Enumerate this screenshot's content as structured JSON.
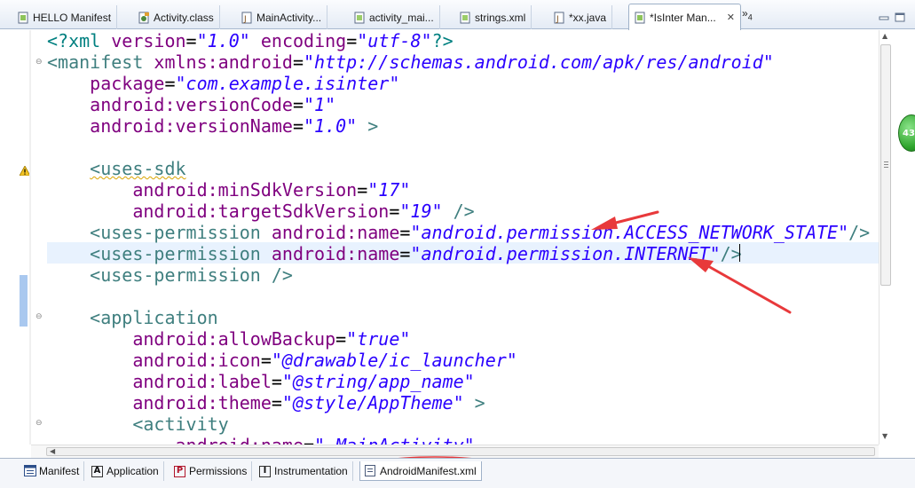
{
  "editor_tabs": [
    {
      "label": "HELLO Manifest",
      "icon": "android-manifest-icon"
    },
    {
      "label": "Activity.class",
      "icon": "class-file-icon"
    },
    {
      "label": "MainActivity...",
      "icon": "java-file-icon"
    },
    {
      "label": "activity_mai...",
      "icon": "xml-file-icon"
    },
    {
      "label": "strings.xml",
      "icon": "xml-file-icon"
    },
    {
      "label": "*xx.java",
      "icon": "java-file-icon"
    },
    {
      "label": "*IsInter Man...",
      "icon": "android-manifest-icon",
      "active": true
    }
  ],
  "tab_overflow": {
    "symbol": "»",
    "count": "4"
  },
  "code_lines": [
    [
      {
        "t": "<?xml ",
        "c": "punct"
      },
      {
        "t": "version",
        "c": "attr"
      },
      {
        "t": "=",
        "c": "plain"
      },
      {
        "t": "\"1.0\"",
        "c": "val"
      },
      {
        "t": " ",
        "c": "plain"
      },
      {
        "t": "encoding",
        "c": "attr"
      },
      {
        "t": "=",
        "c": "plain"
      },
      {
        "t": "\"utf-8\"",
        "c": "val"
      },
      {
        "t": "?>",
        "c": "punct"
      }
    ],
    [
      {
        "t": "<manifest ",
        "c": "tag"
      },
      {
        "t": "xmlns:android",
        "c": "attr"
      },
      {
        "t": "=",
        "c": "plain"
      },
      {
        "t": "\"http://schemas.android.com/apk/res/android\"",
        "c": "val"
      }
    ],
    [
      {
        "t": "    ",
        "c": "plain"
      },
      {
        "t": "package",
        "c": "attr"
      },
      {
        "t": "=",
        "c": "plain"
      },
      {
        "t": "\"com.example.isinter\"",
        "c": "val"
      }
    ],
    [
      {
        "t": "    ",
        "c": "plain"
      },
      {
        "t": "android:versionCode",
        "c": "attr"
      },
      {
        "t": "=",
        "c": "plain"
      },
      {
        "t": "\"1\"",
        "c": "val"
      }
    ],
    [
      {
        "t": "    ",
        "c": "plain"
      },
      {
        "t": "android:versionName",
        "c": "attr"
      },
      {
        "t": "=",
        "c": "plain"
      },
      {
        "t": "\"1.0\"",
        "c": "val"
      },
      {
        "t": " >",
        "c": "tag"
      }
    ],
    [],
    [
      {
        "t": "    ",
        "c": "plain"
      },
      {
        "t": "<uses-sdk",
        "c": "tag",
        "warn": true
      }
    ],
    [
      {
        "t": "        ",
        "c": "plain"
      },
      {
        "t": "android:minSdkVersion",
        "c": "attr"
      },
      {
        "t": "=",
        "c": "plain"
      },
      {
        "t": "\"17\"",
        "c": "val"
      }
    ],
    [
      {
        "t": "        ",
        "c": "plain"
      },
      {
        "t": "android:targetSdkVersion",
        "c": "attr"
      },
      {
        "t": "=",
        "c": "plain"
      },
      {
        "t": "\"19\"",
        "c": "val"
      },
      {
        "t": " />",
        "c": "tag"
      }
    ],
    [
      {
        "t": "    ",
        "c": "plain"
      },
      {
        "t": "<uses-permission ",
        "c": "tag"
      },
      {
        "t": "android:name",
        "c": "attr"
      },
      {
        "t": "=",
        "c": "plain"
      },
      {
        "t": "\"android.permission.ACCESS_NETWORK_STATE\"",
        "c": "val"
      },
      {
        "t": "/>",
        "c": "tag"
      }
    ],
    [
      {
        "t": "    ",
        "c": "plain"
      },
      {
        "t": "<uses-permission ",
        "c": "tag"
      },
      {
        "t": "android:name",
        "c": "attr"
      },
      {
        "t": "=",
        "c": "plain"
      },
      {
        "t": "\"android.permission.INTERNET\"",
        "c": "val"
      },
      {
        "t": "/>",
        "c": "tag"
      }
    ],
    [
      {
        "t": "    ",
        "c": "plain"
      },
      {
        "t": "<uses-permission />",
        "c": "tag"
      }
    ],
    [],
    [
      {
        "t": "    ",
        "c": "plain"
      },
      {
        "t": "<application",
        "c": "tag"
      }
    ],
    [
      {
        "t": "        ",
        "c": "plain"
      },
      {
        "t": "android:allowBackup",
        "c": "attr"
      },
      {
        "t": "=",
        "c": "plain"
      },
      {
        "t": "\"true\"",
        "c": "val"
      }
    ],
    [
      {
        "t": "        ",
        "c": "plain"
      },
      {
        "t": "android:icon",
        "c": "attr"
      },
      {
        "t": "=",
        "c": "plain"
      },
      {
        "t": "\"@drawable/ic_launcher\"",
        "c": "val"
      }
    ],
    [
      {
        "t": "        ",
        "c": "plain"
      },
      {
        "t": "android:label",
        "c": "attr"
      },
      {
        "t": "=",
        "c": "plain"
      },
      {
        "t": "\"@string/app_name\"",
        "c": "val"
      }
    ],
    [
      {
        "t": "        ",
        "c": "plain"
      },
      {
        "t": "android:theme",
        "c": "attr"
      },
      {
        "t": "=",
        "c": "plain"
      },
      {
        "t": "\"@style/AppTheme\"",
        "c": "val"
      },
      {
        "t": " >",
        "c": "tag"
      }
    ],
    [
      {
        "t": "        ",
        "c": "plain"
      },
      {
        "t": "<activity",
        "c": "tag"
      }
    ],
    [
      {
        "t": "            ",
        "c": "plain"
      },
      {
        "t": "android:name",
        "c": "attr"
      },
      {
        "t": "=",
        "c": "plain"
      },
      {
        "t": "\".MainActivity\"",
        "c": "val"
      }
    ]
  ],
  "overview_badge": "43",
  "page_tabs": [
    {
      "label": "Manifest",
      "icon": "overview-page-icon"
    },
    {
      "label": "Application",
      "icon": "application-page-icon",
      "letter": "A"
    },
    {
      "label": "Permissions",
      "icon": "permissions-page-icon",
      "letter": "P"
    },
    {
      "label": "Instrumentation",
      "icon": "instrumentation-page-icon",
      "letter": "I"
    },
    {
      "label": "AndroidManifest.xml",
      "icon": "xml-source-icon",
      "active": true
    }
  ],
  "colors": {
    "tag": "#3f7f7f",
    "attribute": "#7f007f",
    "value": "#2a00ff",
    "current_line": "#e8f2fe",
    "annotation_red": "#e8393b"
  }
}
